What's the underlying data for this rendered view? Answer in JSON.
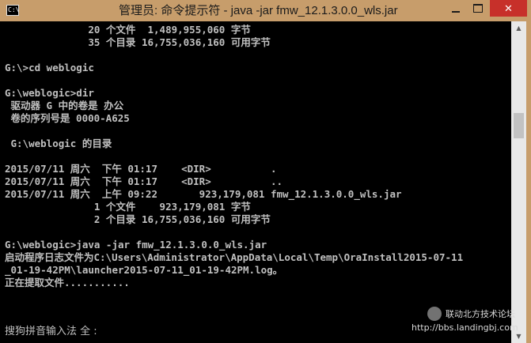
{
  "window": {
    "title": "管理员: 命令提示符 - java  -jar fmw_12.1.3.0.0_wls.jar",
    "icon_text": "C:\\",
    "minimize_icon": "minimize-icon",
    "maximize_icon": "maximize-icon",
    "close_glyph": "✕"
  },
  "console": {
    "lines": [
      "              20 个文件  1,489,955,060 字节",
      "              35 个目录 16,755,036,160 可用字节",
      "",
      "G:\\>cd weblogic",
      "",
      "G:\\weblogic>dir",
      " 驱动器 G 中的卷是 办公",
      " 卷的序列号是 0000-A625",
      "",
      " G:\\weblogic 的目录",
      "",
      "2015/07/11 周六  下午 01:17    <DIR>          .",
      "2015/07/11 周六  下午 01:17    <DIR>          ..",
      "2015/07/11 周六  上午 09:22       923,179,081 fmw_12.1.3.0.0_wls.jar",
      "               1 个文件    923,179,081 字节",
      "               2 个目录 16,755,036,160 可用字节",
      "",
      "G:\\weblogic>java -jar fmw_12.1.3.0.0_wls.jar",
      "启动程序日志文件为C:\\Users\\Administrator\\AppData\\Local\\Temp\\OraInstall2015-07-11",
      "_01-19-42PM\\launcher2015-07-11_01-19-42PM.log。",
      "正在提取文件..........."
    ],
    "ime_status": "搜狗拼音输入法 全 :"
  },
  "watermark": {
    "name": "联动北方技术论坛",
    "url": "http://bbs.landingbj.com"
  },
  "colors": {
    "title_bar": "#c79d6b",
    "close_button": "#c7302a",
    "console_bg": "#000000",
    "console_text": "#c0c0c0"
  }
}
